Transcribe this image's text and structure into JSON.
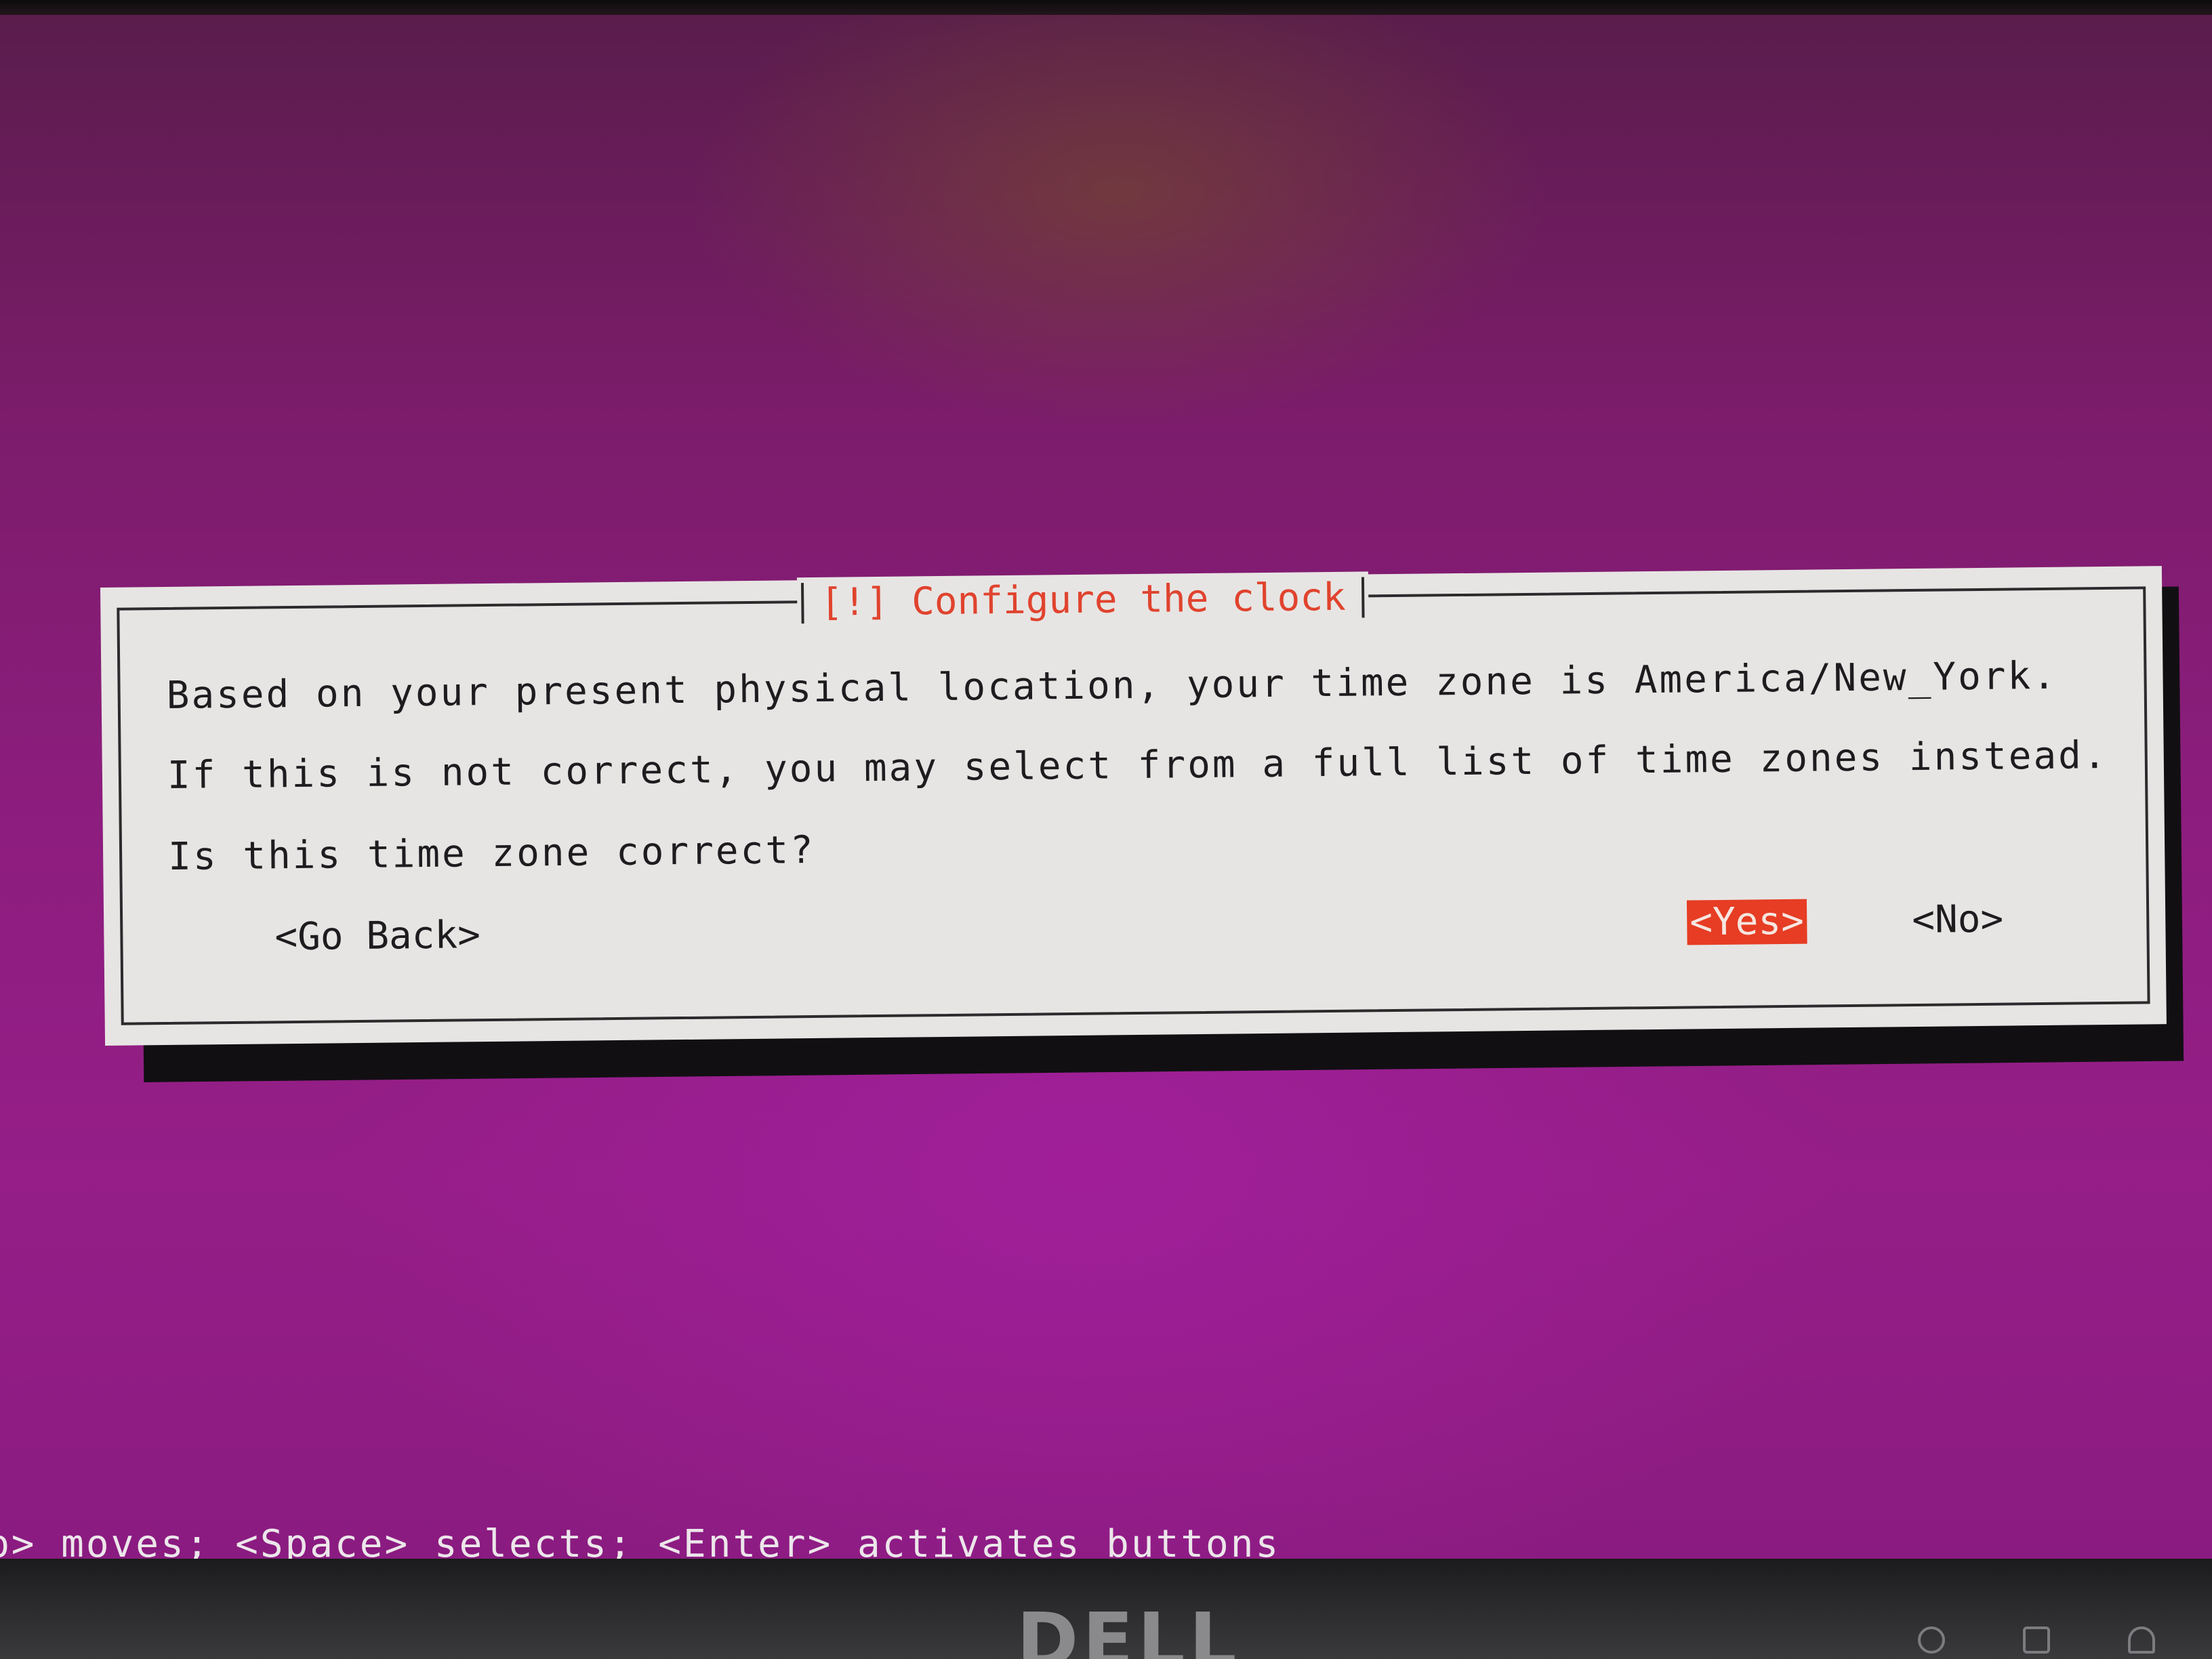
{
  "dialog": {
    "title": "[!] Configure the clock",
    "line1": "Based on your present physical location, your time zone is America/New_York.",
    "line2": "If this is not correct, you may select from a full list of time zones instead.",
    "question": "Is this time zone correct?",
    "buttons": {
      "go_back": "<Go Back>",
      "yes": "<Yes>",
      "no": "<No>"
    }
  },
  "help_line": "b> moves; <Space> selects; <Enter> activates buttons",
  "monitor": {
    "brand": "DELL"
  },
  "colors": {
    "background": "#8c1d7d",
    "dialog_bg": "#e7e5e3",
    "title": "#e0432e",
    "selected_button": "#e63d24"
  }
}
